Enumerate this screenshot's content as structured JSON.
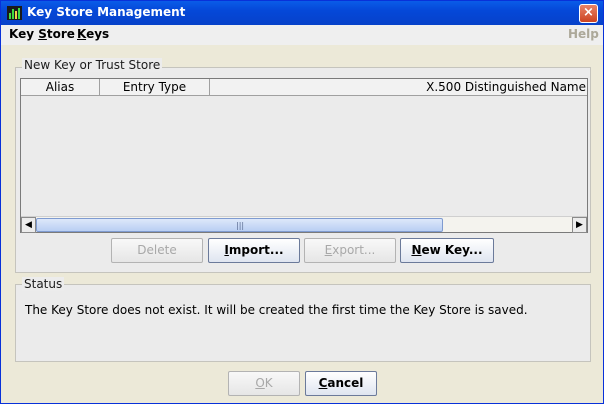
{
  "window": {
    "title": "Key Store Management",
    "close_glyph": "×"
  },
  "menubar": {
    "items": [
      {
        "label_prefix": "Key ",
        "label_ul": "S",
        "label_suffix": "tore"
      },
      {
        "label_prefix": "",
        "label_ul": "K",
        "label_suffix": "eys"
      }
    ],
    "help_label": "Help"
  },
  "store_group": {
    "title": "New Key or Trust Store",
    "columns": [
      "Alias",
      "Entry Type",
      "X.500 Distinguished Name"
    ],
    "rows": [],
    "scrollbar_glyphs": {
      "left": "◀",
      "right": "▶",
      "grip": "|||"
    }
  },
  "buttons": {
    "delete_label": "Delete",
    "import": {
      "ul": "I",
      "rest": "mport..."
    },
    "export": {
      "ul": "E",
      "rest": "xport..."
    },
    "newkey": {
      "ul": "N",
      "rest": "ew Key..."
    },
    "ok": {
      "ul": "O",
      "rest": "K"
    },
    "cancel": {
      "ul": "C",
      "rest": "ancel"
    }
  },
  "status_group": {
    "title": "Status",
    "message": "The Key Store does not exist.  It will be created the first time the Key Store is saved."
  }
}
